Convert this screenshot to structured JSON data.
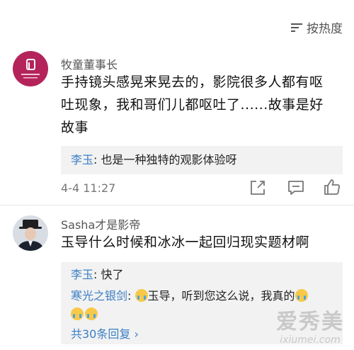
{
  "sort": {
    "label": "按热度"
  },
  "comments": [
    {
      "author": "牧童董事长",
      "lines": [
        "手持镜头感晃来晃去的，影院很多人都有呕",
        "吐现象，我和哥们儿都呕吐了......故事是好",
        "故事"
      ],
      "reply": {
        "name": "李玉",
        "sep": ": ",
        "text": "也是一种独特的观影体验呀"
      },
      "time": "4-4 11:27"
    },
    {
      "author": "Sasha才是影帝",
      "lines": [
        "玉导什么时候和冰冰一起回归现实题材啊"
      ],
      "replies": [
        {
          "name": "李玉",
          "sep": ": ",
          "text": "快了"
        },
        {
          "name": "寒光之银剑",
          "sep": ": ",
          "text": "玉导，听到您这么说，我真的"
        }
      ],
      "more": "共30条回复 ›"
    }
  ],
  "watermark": {
    "title": "爱秀美",
    "url": "ixiumei.com"
  }
}
